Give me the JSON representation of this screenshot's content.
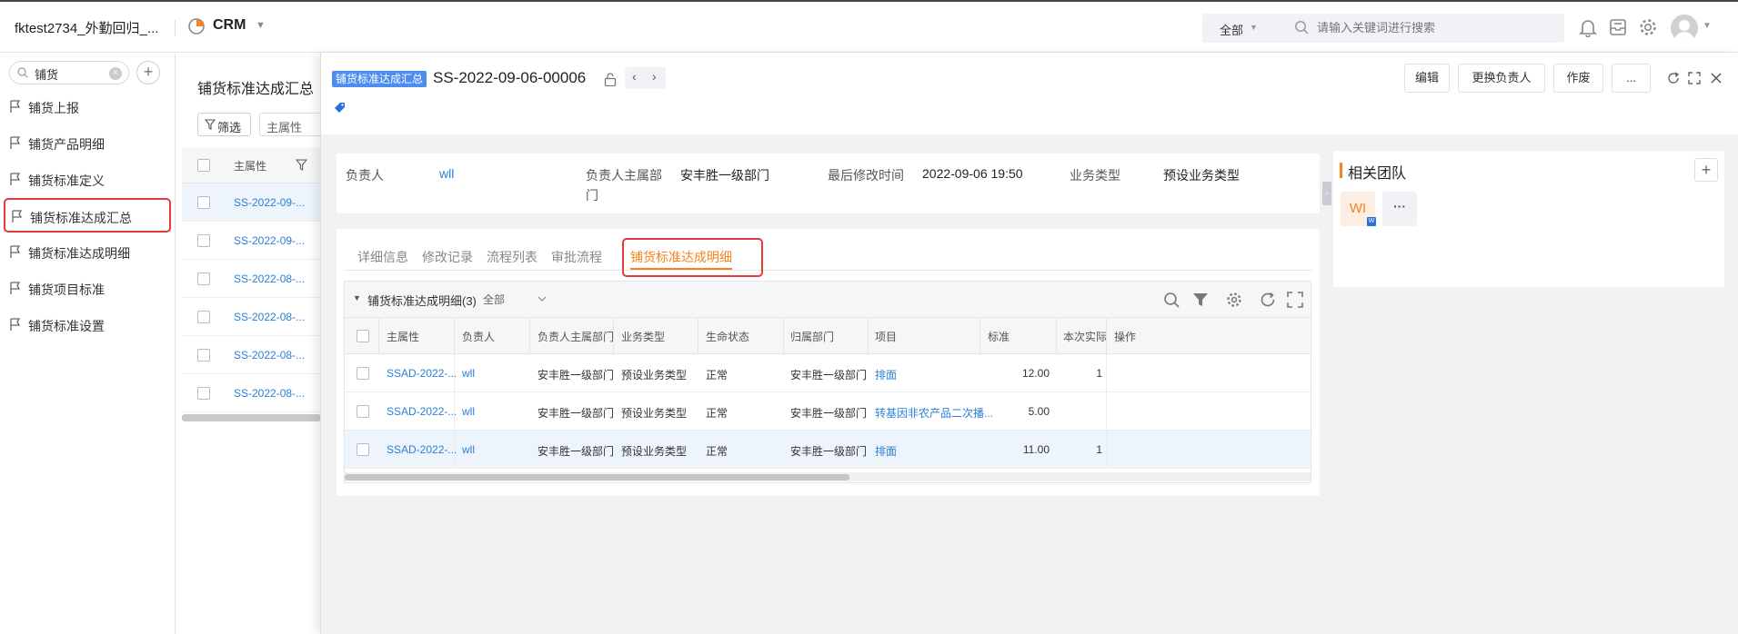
{
  "topbar": {
    "tenant": "fktest2734_外勤回归_...",
    "app_name": "CRM",
    "search_scope": "全部",
    "search_placeholder": "请输入关键词进行搜索"
  },
  "nav": {
    "search_value": "铺货",
    "items": [
      {
        "label": "铺货上报"
      },
      {
        "label": "铺货产品明细"
      },
      {
        "label": "铺货标准定义"
      },
      {
        "label": "铺货标准达成汇总",
        "highlighted": true
      },
      {
        "label": "铺货标准达成明细"
      },
      {
        "label": "铺货项目标准"
      },
      {
        "label": "铺货标准设置"
      }
    ]
  },
  "list": {
    "title": "铺货标准达成汇总",
    "filter_label": "筛选",
    "attr_placeholder": "主属性",
    "col_header": "主属性",
    "rows": [
      "SS-2022-09-...",
      "SS-2022-09-...",
      "SS-2022-08-...",
      "SS-2022-08-...",
      "SS-2022-08-...",
      "SS-2022-08-..."
    ]
  },
  "detail": {
    "object_tag": "铺货标准达成汇总",
    "record_id": "SS-2022-09-06-00006",
    "actions": {
      "edit": "编辑",
      "change_owner": "更换负责人",
      "void": "作废",
      "more": "..."
    },
    "info": {
      "owner_label": "负责人",
      "owner_value": "wll",
      "dept_label_1": "负责人主属部",
      "dept_label_2": "门",
      "dept_value": "安丰胜一级部门",
      "modified_label": "最后修改时间",
      "modified_value": "2022-09-06 19:50",
      "biztype_label": "业务类型",
      "biztype_value": "预设业务类型"
    },
    "tabs": [
      "详细信息",
      "修改记录",
      "流程列表",
      "审批流程",
      "铺货标准达成明细"
    ],
    "active_tab": "铺货标准达成明细",
    "team": {
      "title": "相关团队",
      "member_initials": "WI",
      "badge": "W",
      "more": "···"
    },
    "subtable": {
      "title": "铺货标准达成明细(3)",
      "scope": "全部",
      "columns": [
        "主属性",
        "负责人",
        "负责人主属部门",
        "业务类型",
        "生命状态",
        "归属部门",
        "项目",
        "标准",
        "本次实际",
        "操作"
      ],
      "rows": [
        {
          "attr": "SSAD-2022-...",
          "owner": "wll",
          "dept": "安丰胜一级部门",
          "biztype": "预设业务类型",
          "status": "正常",
          "belong": "安丰胜一级部门",
          "project": "排面",
          "standard": "12.00",
          "actual": "1"
        },
        {
          "attr": "SSAD-2022-...",
          "owner": "wll",
          "dept": "安丰胜一级部门",
          "biztype": "预设业务类型",
          "status": "正常",
          "belong": "安丰胜一级部门",
          "project": "转基因非农产品二次播...",
          "standard": "5.00",
          "actual": ""
        },
        {
          "attr": "SSAD-2022-...",
          "owner": "wll",
          "dept": "安丰胜一级部门",
          "biztype": "预设业务类型",
          "status": "正常",
          "belong": "安丰胜一级部门",
          "project": "排面",
          "standard": "11.00",
          "actual": "1"
        }
      ]
    }
  },
  "colors": {
    "accent": "#f5831f",
    "link": "#2b7fd8",
    "tag_bg": "#4e8df0",
    "highlight_box": "#e23b3b"
  }
}
